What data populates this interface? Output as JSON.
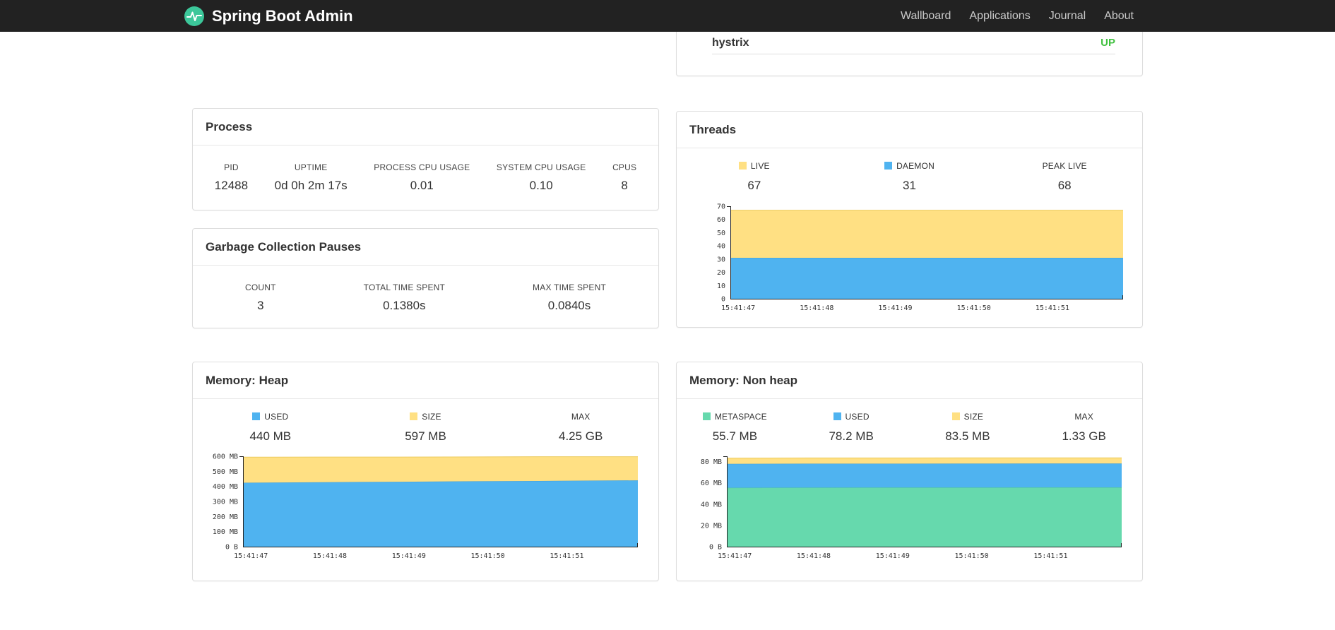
{
  "navbar": {
    "brand": "Spring Boot Admin",
    "items": [
      {
        "label": "Wallboard"
      },
      {
        "label": "Applications"
      },
      {
        "label": "Journal"
      },
      {
        "label": "About"
      }
    ]
  },
  "application_row": {
    "name": "hystrix",
    "status": "UP",
    "status_color": "#42c141"
  },
  "colors": {
    "navbar_bg": "#222222",
    "logo_green": "#3cc79a",
    "chart_blue": "#4FB3F0",
    "chart_yellow": "#FFE083",
    "chart_green": "#66D9AD",
    "status_up": "#42c141"
  },
  "cards": {
    "process": {
      "title": "Process",
      "stats": [
        {
          "label": "PID",
          "value": "12488"
        },
        {
          "label": "UPTIME",
          "value": "0d 0h 2m 17s"
        },
        {
          "label": "PROCESS CPU USAGE",
          "value": "0.01"
        },
        {
          "label": "SYSTEM CPU USAGE",
          "value": "0.10"
        },
        {
          "label": "CPUS",
          "value": "8"
        }
      ]
    },
    "gc": {
      "title": "Garbage Collection Pauses",
      "stats": [
        {
          "label": "COUNT",
          "value": "3"
        },
        {
          "label": "TOTAL TIME SPENT",
          "value": "0.1380s"
        },
        {
          "label": "MAX TIME SPENT",
          "value": "0.0840s"
        }
      ]
    },
    "threads": {
      "title": "Threads",
      "legend": [
        {
          "label": "LIVE",
          "value": "67",
          "color": "#FFE083"
        },
        {
          "label": "DAEMON",
          "value": "31",
          "color": "#4FB3F0"
        },
        {
          "label": "PEAK LIVE",
          "value": "68",
          "color": null
        }
      ]
    },
    "heap": {
      "title": "Memory: Heap",
      "legend": [
        {
          "label": "USED",
          "value": "440 MB",
          "color": "#4FB3F0"
        },
        {
          "label": "SIZE",
          "value": "597 MB",
          "color": "#FFE083"
        },
        {
          "label": "MAX",
          "value": "4.25 GB",
          "color": null
        }
      ]
    },
    "nonheap": {
      "title": "Memory: Non heap",
      "legend": [
        {
          "label": "METASPACE",
          "value": "55.7 MB",
          "color": "#66D9AD"
        },
        {
          "label": "USED",
          "value": "78.2 MB",
          "color": "#4FB3F0"
        },
        {
          "label": "SIZE",
          "value": "83.5 MB",
          "color": "#FFE083"
        },
        {
          "label": "MAX",
          "value": "1.33 GB",
          "color": null
        }
      ]
    }
  },
  "chart_data": [
    {
      "id": "threads",
      "type": "area",
      "stacked": true,
      "title": "Threads",
      "xlabel": "",
      "ylabel": "",
      "legend_position": "top",
      "grid": false,
      "x": [
        "15:41:47",
        "15:41:48",
        "15:41:49",
        "15:41:50",
        "15:41:51"
      ],
      "ylim": [
        0,
        70
      ],
      "yticks": [
        {
          "v": 0,
          "label": "0"
        },
        {
          "v": 10,
          "label": "10"
        },
        {
          "v": 20,
          "label": "20"
        },
        {
          "v": 30,
          "label": "30"
        },
        {
          "v": 40,
          "label": "40"
        },
        {
          "v": 50,
          "label": "50"
        },
        {
          "v": 60,
          "label": "60"
        },
        {
          "v": 70,
          "label": "70"
        }
      ],
      "series": [
        {
          "name": "DAEMON",
          "color": "#4FB3F0",
          "stroke": "#3E9CD9",
          "tops": [
            31,
            31,
            31,
            31,
            31,
            31
          ]
        },
        {
          "name": "LIVE",
          "color": "#FFE083",
          "stroke": "#ECCB5E",
          "tops": [
            67,
            67,
            67,
            67,
            67,
            67
          ]
        }
      ]
    },
    {
      "id": "heap",
      "type": "area",
      "stacked": true,
      "title": "Memory: Heap",
      "xlabel": "",
      "ylabel": "",
      "legend_position": "top",
      "grid": false,
      "x": [
        "15:41:47",
        "15:41:48",
        "15:41:49",
        "15:41:50",
        "15:41:51"
      ],
      "ylim": [
        0,
        600
      ],
      "yticks": [
        {
          "v": 0,
          "label": "0 B"
        },
        {
          "v": 100,
          "label": "100 MB"
        },
        {
          "v": 200,
          "label": "200 MB"
        },
        {
          "v": 300,
          "label": "300 MB"
        },
        {
          "v": 400,
          "label": "400 MB"
        },
        {
          "v": 500,
          "label": "500 MB"
        },
        {
          "v": 600,
          "label": "600 MB"
        }
      ],
      "series": [
        {
          "name": "USED",
          "color": "#4FB3F0",
          "stroke": "#3E9CD9",
          "tops": [
            424,
            428,
            431,
            434,
            437,
            440
          ]
        },
        {
          "name": "SIZE",
          "color": "#FFE083",
          "stroke": "#ECCB5E",
          "tops": [
            594,
            595,
            595,
            596,
            597,
            597
          ]
        }
      ]
    },
    {
      "id": "nonheap",
      "type": "area",
      "stacked": true,
      "title": "Memory: Non heap",
      "xlabel": "",
      "ylabel": "",
      "legend_position": "top",
      "grid": false,
      "x": [
        "15:41:47",
        "15:41:48",
        "15:41:49",
        "15:41:50",
        "15:41:51"
      ],
      "ylim": [
        0,
        85
      ],
      "yticks": [
        {
          "v": 0,
          "label": "0 B"
        },
        {
          "v": 20,
          "label": "20 MB"
        },
        {
          "v": 40,
          "label": "40 MB"
        },
        {
          "v": 60,
          "label": "60 MB"
        },
        {
          "v": 80,
          "label": "80 MB"
        }
      ],
      "series": [
        {
          "name": "METASPACE",
          "color": "#66D9AD",
          "stroke": "#50C497",
          "tops": [
            55.4,
            55.5,
            55.6,
            55.6,
            55.7,
            55.7
          ]
        },
        {
          "name": "USED",
          "color": "#4FB3F0",
          "stroke": "#3E9CD9",
          "tops": [
            77.9,
            78.0,
            78.0,
            78.1,
            78.2,
            78.2
          ]
        },
        {
          "name": "SIZE",
          "color": "#FFE083",
          "stroke": "#ECCB5E",
          "tops": [
            83.3,
            83.4,
            83.4,
            83.5,
            83.5,
            83.5
          ]
        }
      ]
    }
  ]
}
